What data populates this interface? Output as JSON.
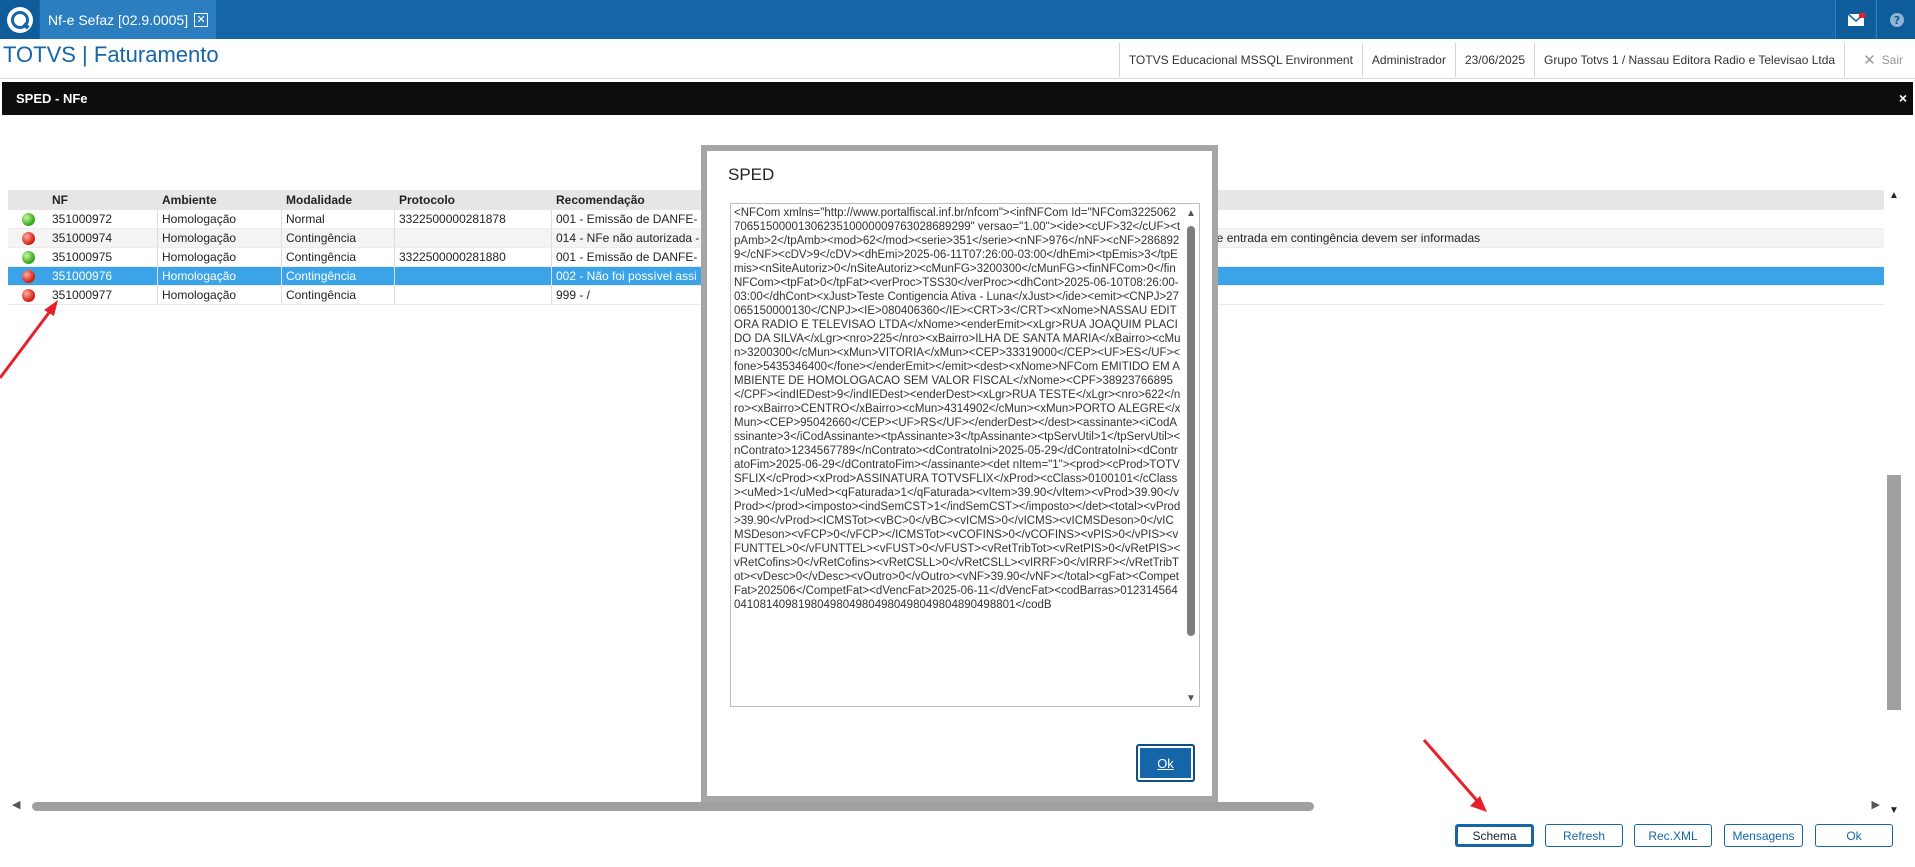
{
  "topbar": {
    "tab_label": "Nf-e Sefaz [02.9.0005]",
    "tab_close": "✕",
    "icons": [
      "home-icon",
      "mail-icon",
      "help-icon"
    ]
  },
  "header": {
    "brand": "TOTVS | Faturamento",
    "environment": "TOTVS Educacional MSSQL Environment",
    "user": "Administrador",
    "date": "23/06/2025",
    "company": "Grupo Totvs 1 / Nassau Editora Radio e Televisao Ltda",
    "exit_label": "Sair"
  },
  "window": {
    "title": "SPED - NFe",
    "close": "×"
  },
  "grid": {
    "columns": [
      "NF",
      "Ambiente",
      "Modalidade",
      "Protocolo",
      "Recomendação"
    ],
    "rows": [
      {
        "status": "green",
        "nf": "351000972",
        "ambiente": "Homologação",
        "modalidade": "Normal",
        "protocolo": "3322500000281878",
        "recomendacao": "001 - Emissão de DANFE-",
        "tail": ""
      },
      {
        "status": "red",
        "nf": "351000974",
        "ambiente": "Homologação",
        "modalidade": "Contingência",
        "protocolo": "",
        "recomendacao": "014 - NFe não autorizada -",
        "tail": "a de entrada em contingência devem ser informadas"
      },
      {
        "status": "green",
        "nf": "351000975",
        "ambiente": "Homologação",
        "modalidade": "Contingência",
        "protocolo": "3322500000281880",
        "recomendacao": "001 - Emissão de DANFE-",
        "tail": ""
      },
      {
        "status": "red",
        "nf": "351000976",
        "ambiente": "Homologação",
        "modalidade": "Contingência",
        "protocolo": "",
        "recomendacao": "002 - Não foi possível assi",
        "tail": "",
        "selected": true
      },
      {
        "status": "red",
        "nf": "351000977",
        "ambiente": "Homologação",
        "modalidade": "Contingência",
        "protocolo": "",
        "recomendacao": "999 - /",
        "tail": ""
      }
    ]
  },
  "buttons": {
    "schema": "Schema",
    "refresh": "Refresh",
    "recxml": "Rec.XML",
    "mensagens": "Mensagens",
    "ok": "Ok"
  },
  "modal": {
    "title": "SPED",
    "xml": "<NFCom xmlns=\"http://www.portalfiscal.inf.br/nfcom\"><infNFCom Id=\"NFCom32250627065150000130623510000009763028689299\" versao=\"1.00\"><ide><cUF>32</cUF><tpAmb>2</tpAmb><mod>62</mod><serie>351</serie><nNF>976</nNF><cNF>2868929</cNF><cDV>9</cDV><dhEmi>2025-06-11T07:26:00-03:00</dhEmi><tpEmis>3</tpEmis><nSiteAutoriz>0</nSiteAutoriz><cMunFG>3200300</cMunFG><finNFCom>0</finNFCom><tpFat>0</tpFat><verProc>TSS30</verProc><dhCont>2025-06-10T08:26:00-03:00</dhCont><xJust>Teste Contigencia Ativa - Luna</xJust></ide><emit><CNPJ>27065150000130</CNPJ><IE>080406360</IE><CRT>3</CRT><xNome>NASSAU EDITORA RADIO E TELEVISAO LTDA</xNome><enderEmit><xLgr>RUA JOAQUIM PLACIDO DA SILVA</xLgr><nro>225</nro><xBairro>ILHA DE SANTA MARIA</xBairro><cMun>3200300</cMun><xMun>VITORIA</xMun><CEP>33319000</CEP><UF>ES</UF><fone>5435346400</fone></enderEmit></emit><dest><xNome>NFCom EMITIDO EM AMBIENTE DE HOMOLOGACAO SEM VALOR FISCAL</xNome><CPF>38923766895</CPF><indIEDest>9</indIEDest><enderDest><xLgr>RUA TESTE</xLgr><nro>622</nro><xBairro>CENTRO</xBairro><cMun>4314902</cMun><xMun>PORTO ALEGRE</xMun><CEP>95042660</CEP><UF>RS</UF></enderDest></dest><assinante><iCodAssinante>3</iCodAssinante><tpAssinante>3</tpAssinante><tpServUtil>1</tpServUtil><nContrato>1234567789</nContrato><dContratoIni>2025-05-29</dContratoIni><dContratoFim>2025-06-29</dContratoFim></assinante><det nItem=\"1\"><prod><cProd>TOTVSFLIX</cProd><xProd>ASSINATURA TOTVSFLIX</xProd><cClass>0100101</cClass><uMed>1</uMed><qFaturada>1</qFaturada><vItem>39.90</vItem><vProd>39.90</vProd></prod><imposto><indSemCST>1</indSemCST></imposto></det><total><vProd>39.90</vProd><ICMSTot><vBC>0</vBC><vICMS>0</vICMS><vICMSDeson>0</vICMSDeson><vFCP>0</vFCP></ICMSTot><vCOFINS>0</vCOFINS><vPIS>0</vPIS><vFUNTTEL>0</vFUNTTEL><vFUST>0</vFUST><vRetTribTot><vRetPIS>0</vRetPIS><vRetCofins>0</vRetCofins><vRetCSLL>0</vRetCSLL><vIRRF>0</vIRRF></vRetTribTot><vDesc>0</vDesc><vOutro>0</vOutro><vNF>39.90</vNF></total><gFat><CompetFat>202506</CompetFat><dVencFat>2025-06-11</dVencFat><codBarras>01231456404108140981980498049804980498049804890498801</codB",
    "ok_label": "Ok"
  },
  "annotation_color": "#e8202a"
}
